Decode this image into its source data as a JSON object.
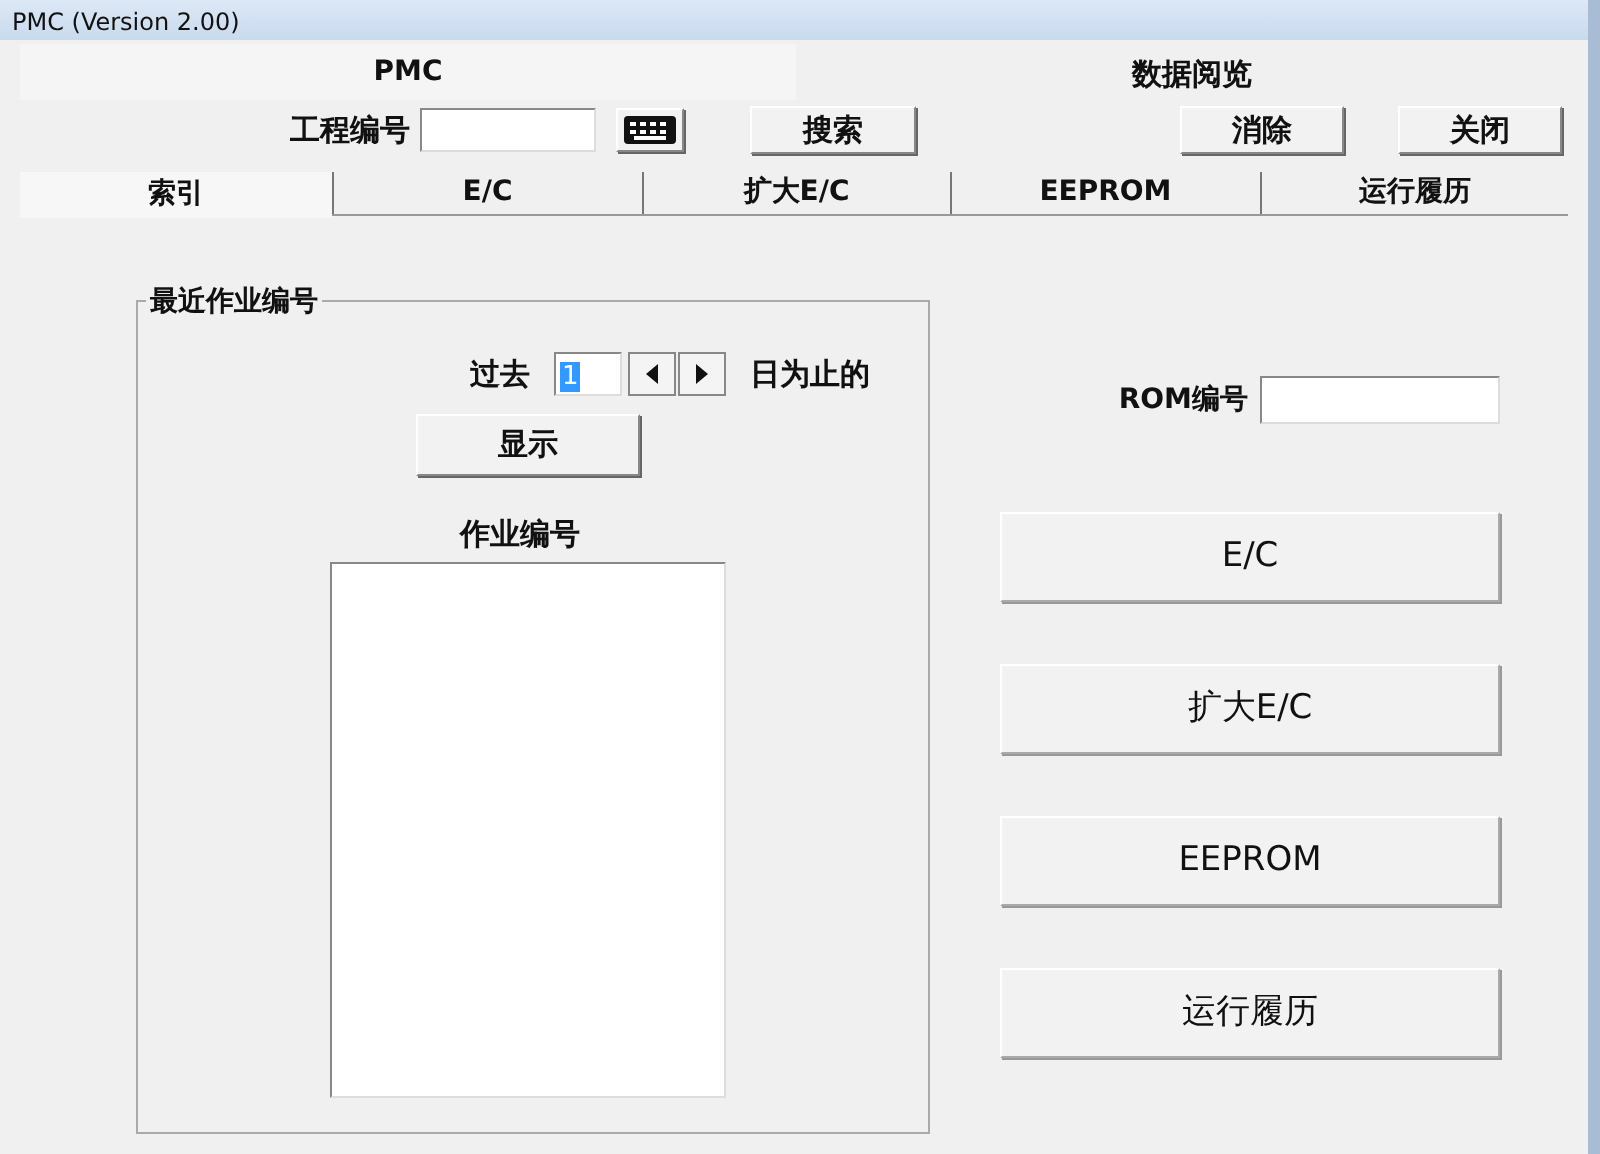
{
  "window": {
    "title": "PMC (Version 2.00)"
  },
  "header": {
    "left_title": "PMC",
    "right_title": "数据阅览"
  },
  "project": {
    "label": "工程编号",
    "search_button": "搜索"
  },
  "top_buttons": [
    "消除",
    "关闭"
  ],
  "tabs": [
    {
      "label": "索引",
      "selected": true
    },
    {
      "label": "E/C",
      "selected": false
    },
    {
      "label": "扩大E/C",
      "selected": false
    },
    {
      "label": "EEPROM",
      "selected": false
    },
    {
      "label": "运行履历",
      "selected": false
    }
  ],
  "recent_group": {
    "title": "最近作业编号",
    "past_label": "过去",
    "days_value": "1",
    "days_suffix": "日为止的",
    "show_button": "显示",
    "list_label": "作业编号"
  },
  "rom": {
    "label": "ROM编号"
  },
  "action_buttons": [
    "E/C",
    "扩大E/C",
    "EEPROM",
    "运行履历"
  ]
}
